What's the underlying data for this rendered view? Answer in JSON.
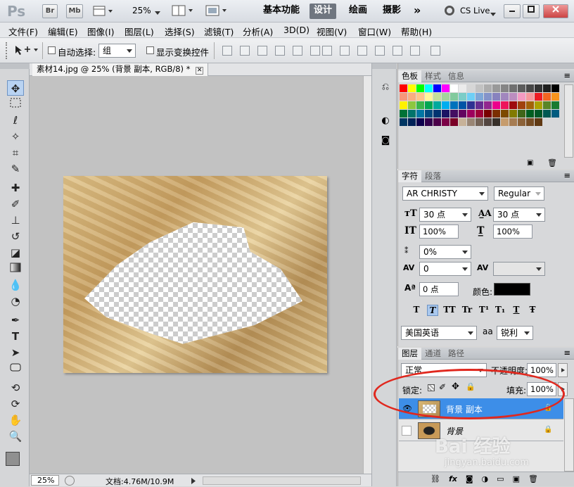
{
  "appbar": {
    "logo": "Ps",
    "bridge": "Br",
    "minibridge": "Mb",
    "zoom": "25%",
    "workspaces": [
      "基本功能",
      "设计",
      "绘画",
      "摄影"
    ],
    "more": "»",
    "cslive": "CS Live"
  },
  "menu": [
    "文件(F)",
    "编辑(E)",
    "图像(I)",
    "图层(L)",
    "选择(S)",
    "滤镜(T)",
    "分析(A)",
    "3D(D)",
    "视图(V)",
    "窗口(W)",
    "帮助(H)"
  ],
  "options": {
    "auto_select_label": "自动选择:",
    "auto_select_value": "组",
    "show_transform_label": "显示变换控件"
  },
  "document": {
    "tab_title": "素材14.jpg @ 25% (背景 副本, RGB/8) *",
    "status_zoom": "25%",
    "status_doc": "文档:4.76M/10.9M"
  },
  "swatches_panel": {
    "tabs": [
      "色板",
      "样式",
      "信息"
    ],
    "colors": [
      "#ff0000",
      "#ffff00",
      "#00ff00",
      "#00ffff",
      "#0000ff",
      "#ff00ff",
      "#ffffff",
      "#ebebeb",
      "#d6d6d6",
      "#c2c2c2",
      "#adadad",
      "#999999",
      "#858585",
      "#707070",
      "#5c5c5c",
      "#474747",
      "#333333",
      "#1f1f1f",
      "#000000",
      "#f7977a",
      "#f9ad81",
      "#fdc68a",
      "#fff79a",
      "#c4df9b",
      "#a3d39c",
      "#82ca9d",
      "#7bcdc8",
      "#6ecff6",
      "#7ea7d8",
      "#8493ca",
      "#8882be",
      "#a187be",
      "#bc8dbf",
      "#f49ac2",
      "#f6989d",
      "#ed1c24",
      "#f26522",
      "#f7941d",
      "#fff200",
      "#8dc73f",
      "#39b54a",
      "#00a651",
      "#00a99d",
      "#00aeef",
      "#0072bc",
      "#0054a6",
      "#2e3192",
      "#662d91",
      "#92278f",
      "#ec008c",
      "#ed145b",
      "#9e0b0f",
      "#a0410d",
      "#a36209",
      "#aba000",
      "#598527",
      "#1a7b30",
      "#007236",
      "#00746b",
      "#0076a3",
      "#004b80",
      "#003471",
      "#1b1464",
      "#440e62",
      "#630460",
      "#9e005d",
      "#9e0039",
      "#790000",
      "#7b2e00",
      "#7d4900",
      "#827b00",
      "#406618",
      "#005e20",
      "#005826",
      "#005952",
      "#005b7f",
      "#003663",
      "#002157",
      "#0d004c",
      "#32004b",
      "#4b0049",
      "#7b0046",
      "#7a0026",
      "#c7b299",
      "#998675",
      "#736357",
      "#534741",
      "#37302a",
      "#c69c6d",
      "#a67c52",
      "#8c6239",
      "#754c24",
      "#603913"
    ]
  },
  "character_panel": {
    "tabs": [
      "字符",
      "段落"
    ],
    "font_family": "AR CHRISTY",
    "font_style": "Regular",
    "size": "30 点",
    "leading": "30 点",
    "vscale": "100%",
    "hscale": "100%",
    "tracking_rate": "0%",
    "kerning": "0",
    "baseline": "0 点",
    "color_label": "颜色:",
    "text_color": "#000000",
    "style_buttons": [
      "T",
      "T",
      "TT",
      "Tr",
      "T¹",
      "T₁",
      "T",
      "Ŧ"
    ],
    "language": "美国英语",
    "aa_icon": "aa",
    "antialias": "锐利"
  },
  "layers_panel": {
    "tabs": [
      "图层",
      "通道",
      "路径"
    ],
    "blend_mode": "正常",
    "opacity_label": "不透明度:",
    "opacity": "100%",
    "lock_label": "锁定:",
    "fill_label": "填充:",
    "fill": "100%",
    "layers": [
      {
        "name": "背景 副本",
        "visible": true,
        "selected": true
      },
      {
        "name": "背景",
        "visible": false,
        "selected": false
      }
    ],
    "bottom_icons": [
      "link-icon",
      "fx-icon",
      "mask-icon",
      "adjustment-icon",
      "group-icon",
      "new-layer-icon",
      "trash-icon"
    ]
  },
  "colors": {
    "accent": "#3d8ee8",
    "highlight_oval": "#e0281e"
  },
  "watermark": {
    "brand": "Bai 经验",
    "url": "jingyan.baidu.com"
  }
}
